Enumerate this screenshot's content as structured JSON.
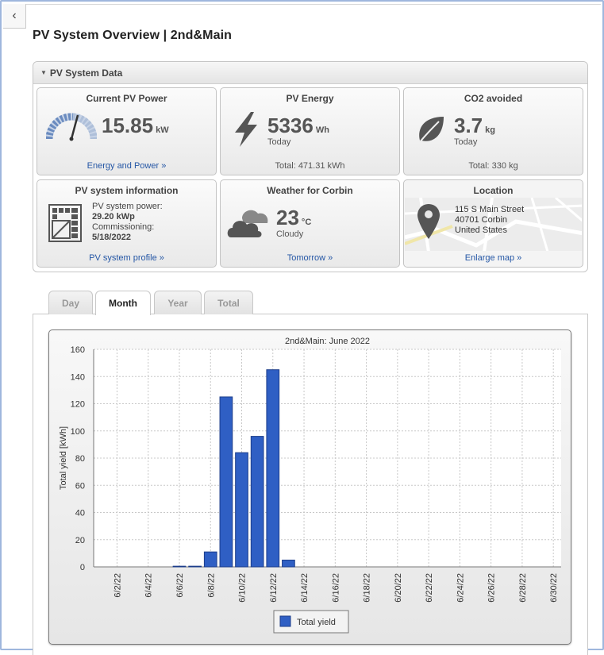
{
  "page": {
    "title": "PV System Overview | 2nd&Main"
  },
  "panel": {
    "title": "PV System Data"
  },
  "tiles": {
    "power": {
      "title": "Current PV Power",
      "value": "15.85",
      "unit": "kW",
      "link": "Energy and Power »"
    },
    "energy": {
      "title": "PV Energy",
      "value": "5336",
      "unit": "Wh",
      "sub": "Today",
      "footer": "Total: 471.31 kWh"
    },
    "co2": {
      "title": "CO2 avoided",
      "value": "3.7",
      "unit": "kg",
      "sub": "Today",
      "footer": "Total: 330 kg"
    },
    "info": {
      "title": "PV system information",
      "power_label": "PV system power:",
      "power_value": "29.20 kWp",
      "commissioning_label": "Commissioning:",
      "commissioning_value": "5/18/2022",
      "link": "PV system profile »"
    },
    "weather": {
      "title": "Weather for Corbin",
      "value": "23",
      "unit": "°C",
      "sub": "Cloudy",
      "link": "Tomorrow »"
    },
    "location": {
      "title": "Location",
      "address1": "115 S Main Street",
      "address2": "40701 Corbin",
      "address3": "United States",
      "link": "Enlarge map »"
    }
  },
  "tabs": [
    {
      "label": "Day",
      "active": false
    },
    {
      "label": "Month",
      "active": true
    },
    {
      "label": "Year",
      "active": false
    },
    {
      "label": "Total",
      "active": false
    }
  ],
  "colors": {
    "bar": "#2f5fc4",
    "bar_border": "#1c3d8a",
    "link": "#2456a5"
  },
  "chart_data": {
    "type": "bar",
    "title": "2nd&Main: June 2022",
    "ylabel": "Total yield [kWh]",
    "xlabel": "",
    "ylim": [
      0,
      160
    ],
    "yticks": [
      0,
      20,
      40,
      60,
      80,
      100,
      120,
      140,
      160
    ],
    "grid": true,
    "legend": {
      "position": "bottom-center",
      "entries": [
        "Total yield"
      ]
    },
    "categories": [
      "6/1/22",
      "6/2/22",
      "6/3/22",
      "6/4/22",
      "6/5/22",
      "6/6/22",
      "6/7/22",
      "6/8/22",
      "6/9/22",
      "6/10/22",
      "6/11/22",
      "6/12/22",
      "6/13/22",
      "6/14/22",
      "6/15/22",
      "6/16/22",
      "6/17/22",
      "6/18/22",
      "6/19/22",
      "6/20/22",
      "6/21/22",
      "6/22/22",
      "6/23/22",
      "6/24/22",
      "6/25/22",
      "6/26/22",
      "6/27/22",
      "6/28/22",
      "6/29/22",
      "6/30/22"
    ],
    "x_tick_labels": [
      "6/2/22",
      "6/4/22",
      "6/6/22",
      "6/8/22",
      "6/10/22",
      "6/12/22",
      "6/14/22",
      "6/16/22",
      "6/18/22",
      "6/20/22",
      "6/22/22",
      "6/24/22",
      "6/26/22",
      "6/28/22",
      "6/30/22"
    ],
    "series": [
      {
        "name": "Total yield",
        "values": [
          0,
          0,
          0,
          0,
          0,
          0.5,
          0.5,
          11,
          125,
          84,
          96,
          145,
          5,
          0,
          0,
          0,
          0,
          0,
          0,
          0,
          0,
          0,
          0,
          0,
          0,
          0,
          0,
          0,
          0,
          0
        ]
      }
    ]
  }
}
